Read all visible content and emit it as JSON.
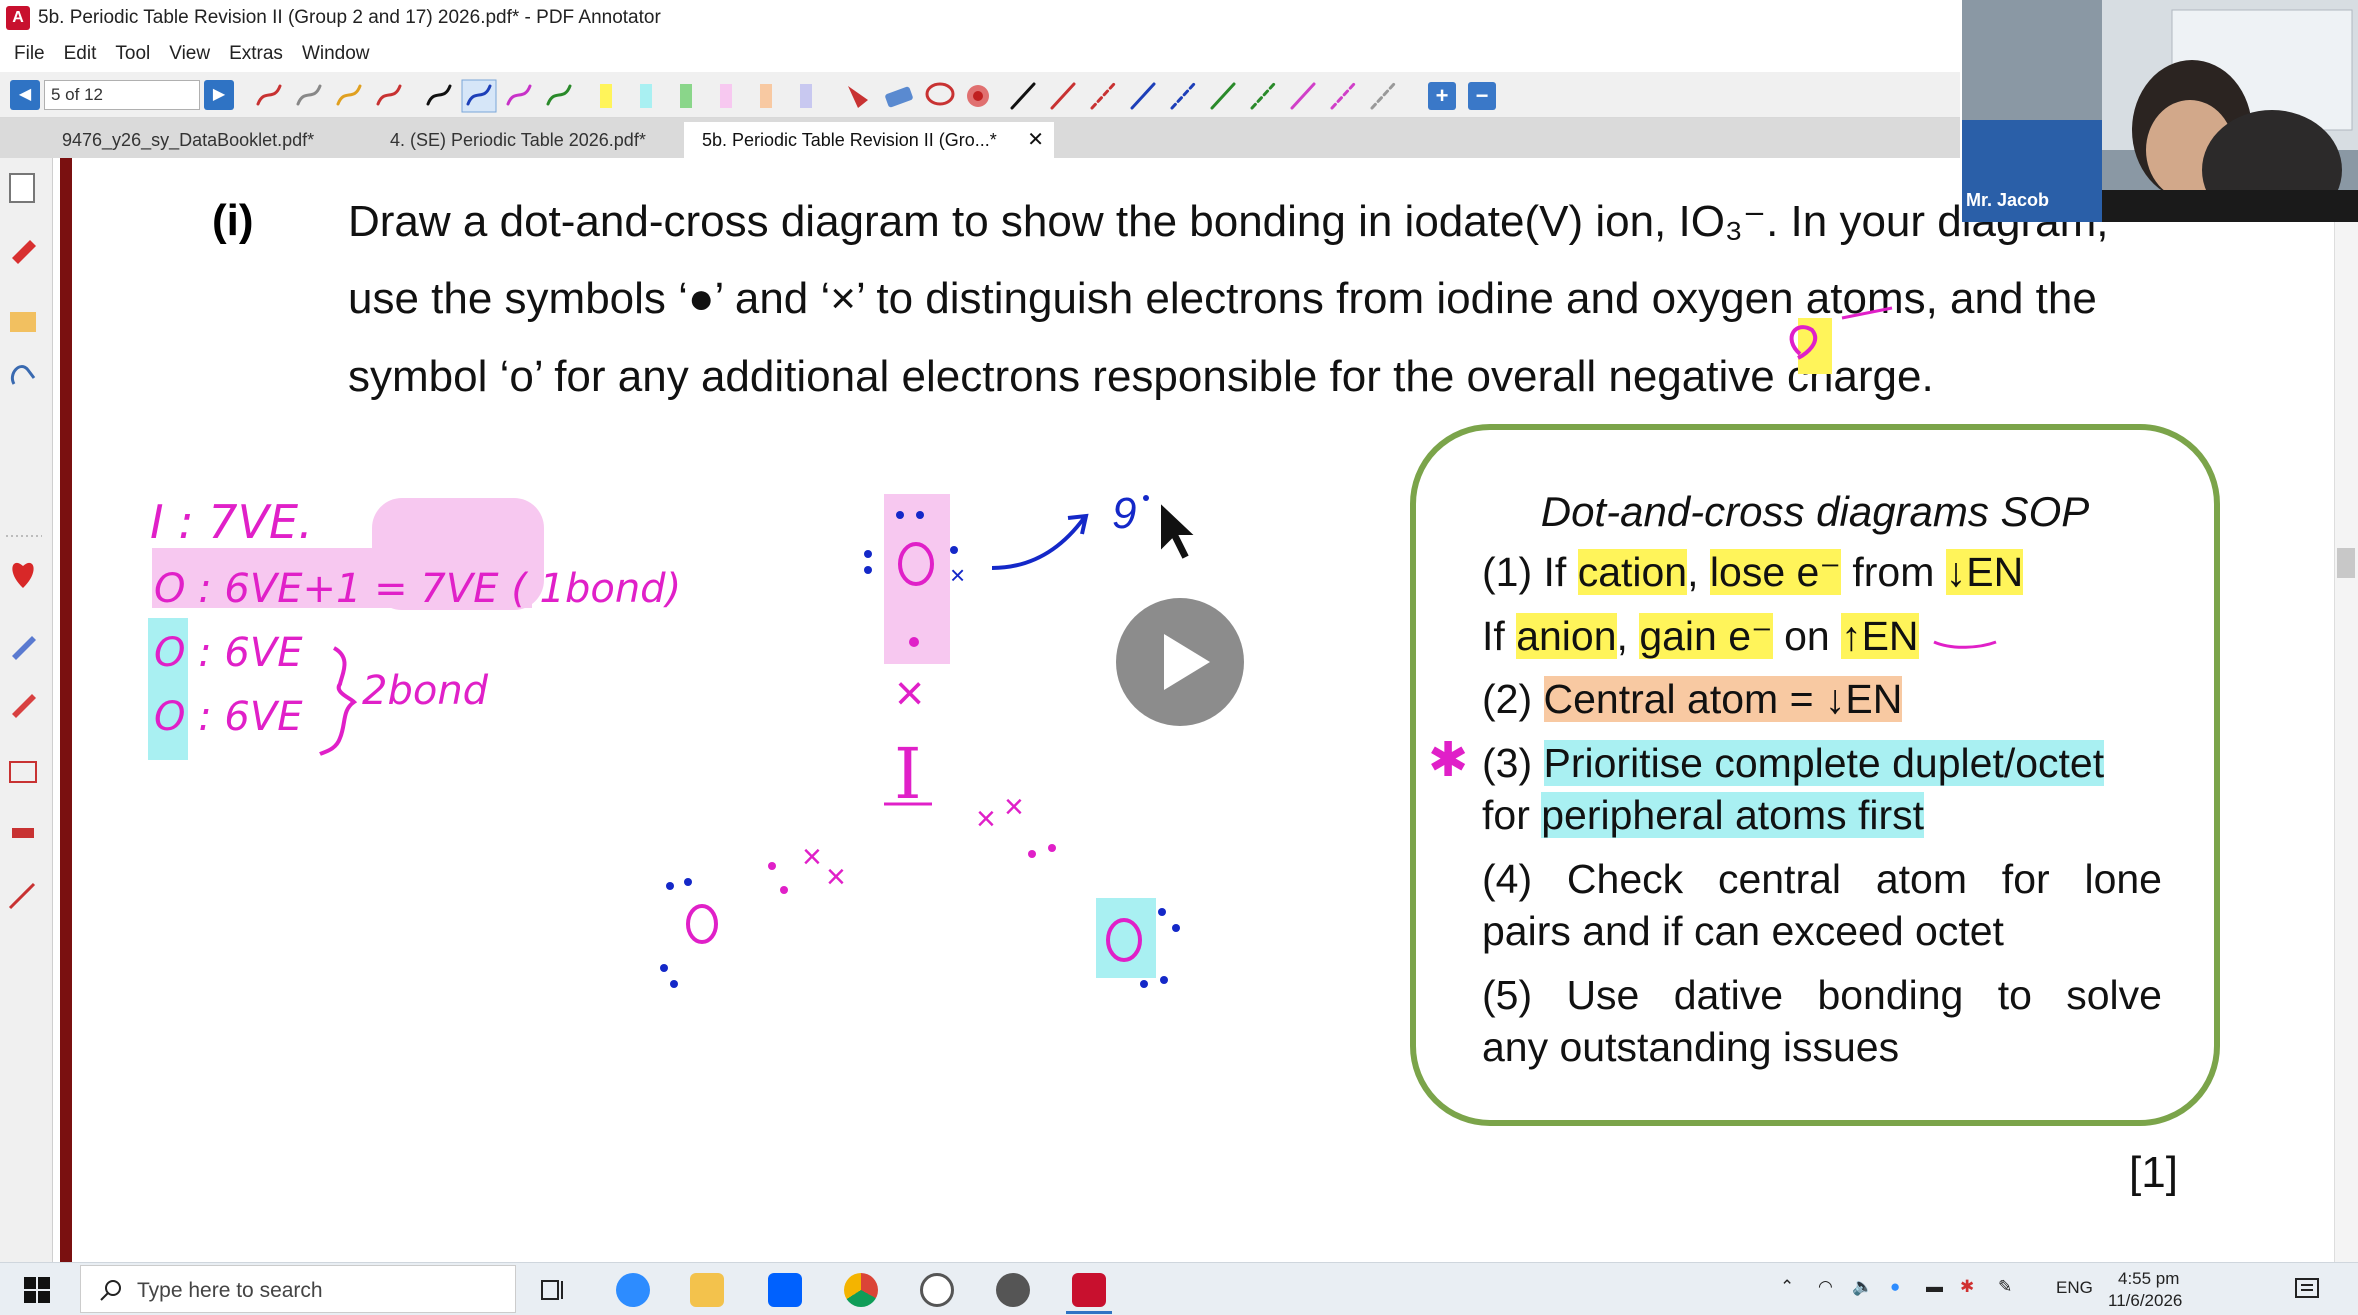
{
  "window": {
    "title": "5b. Periodic Table Revision II (Group 2 and 17) 2026.pdf* - PDF Annotator"
  },
  "menu": [
    "File",
    "Edit",
    "Tool",
    "View",
    "Extras",
    "Window"
  ],
  "toolbar": {
    "page_field": "5 of 12"
  },
  "tabs": [
    {
      "label": "9476_y26_sy_DataBooklet.pdf*",
      "active": false
    },
    {
      "label": "4. (SE) Periodic Table 2026.pdf*",
      "active": false
    },
    {
      "label": "5b. Periodic Table Revision II (Gro...*",
      "active": true
    }
  ],
  "question": {
    "label": "(i)",
    "line1": "Draw a dot-and-cross diagram to show the bonding in iodate(V) ion, IO₃⁻. In your diagram,",
    "line2": "use the symbols ‘●’ and ‘×’ to distinguish electrons from iodine and oxygen atoms, and the",
    "line3": "symbol ‘o’ for any additional electrons responsible for the overall negative charge.",
    "marks": "[1]"
  },
  "sop": {
    "title": "Dot-and-cross diagrams SOP",
    "lines": [
      "(1) If cation, lose e⁻ from ↓EN",
      "If anion, gain e⁻ on ↑EN",
      "(2) Central atom = ↓EN",
      "(3) Prioritise complete duplet/octet",
      "for peripheral atoms first",
      "(4) Check central atom for lone",
      "pairs and if can exceed octet",
      "(5) Use dative bonding to solve",
      "any outstanding issues"
    ]
  },
  "handwriting": {
    "iodine_ve": "I : 7VE.",
    "oxygen_1": "O : 6VE+1 = 7VE ( 1bond)",
    "oxygen_2": "O : 6VE",
    "oxygen_3": "O : 6VE",
    "bonds_note": "2bond"
  },
  "webcam": {
    "name": "Mr. Jacob"
  },
  "taskbar": {
    "search_placeholder": "Type here to search",
    "lang": "ENG",
    "time": "4:55 pm",
    "date": "11/6/2026"
  },
  "colors": {
    "ink_magenta": "#e020c8",
    "ink_blue": "#1428c8",
    "sop_border": "#7ba44a",
    "highlight_yellow": "#fff45a",
    "highlight_orange": "#f8c9a2",
    "highlight_cyan": "#a9f0f2",
    "highlight_pink": "#f7c8f0"
  },
  "icons": [
    "app-icon",
    "prev-page-icon",
    "next-page-icon",
    "pen-icon",
    "highlighter-icon",
    "eraser-icon",
    "lasso-icon",
    "line-icon",
    "zoom-in-icon",
    "zoom-out-icon",
    "play-icon",
    "windows-start-icon",
    "search-icon",
    "task-view-icon",
    "zoom-app-icon",
    "file-explorer-icon",
    "dropbox-icon",
    "chrome-icon",
    "clock-icon",
    "pdf-annotator-icon",
    "notification-icon"
  ]
}
